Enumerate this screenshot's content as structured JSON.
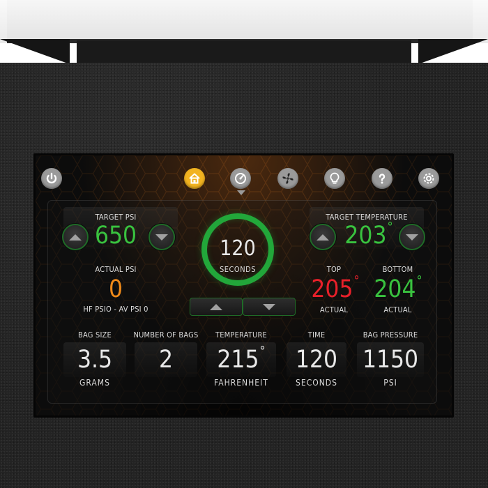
{
  "nav": {
    "icons": [
      {
        "name": "power-icon",
        "active": false
      },
      {
        "name": "home-icon",
        "active": true
      },
      {
        "name": "gauge-icon",
        "active": false
      },
      {
        "name": "fan-icon",
        "active": false
      },
      {
        "name": "lightbulb-icon",
        "active": false
      },
      {
        "name": "help-icon",
        "active": false
      },
      {
        "name": "settings-icon",
        "active": false
      }
    ]
  },
  "target_psi": {
    "label": "TARGET PSI",
    "value": "650"
  },
  "actual_psi": {
    "label": "ACTUAL  PSI",
    "value": "0",
    "sub": "HF PSIO - AV PSI 0"
  },
  "timer": {
    "value": "120",
    "unit": "SECONDS"
  },
  "target_temperature": {
    "label": "TARGET TEMPERATURE",
    "value": "203",
    "deg": "°"
  },
  "top_temp": {
    "label": "TOP",
    "value": "205",
    "deg": "°",
    "sub": "ACTUAL"
  },
  "bottom_temp": {
    "label": "BOTTOM",
    "value": "204",
    "deg": "°",
    "sub": "ACTUAL"
  },
  "stats": [
    {
      "label": "BAG SIZE",
      "value": "3.5",
      "unit": "GRAMS"
    },
    {
      "label": "NUMBER OF BAGS",
      "value": "2",
      "unit": ""
    },
    {
      "label": "TEMPERATURE",
      "value": "215",
      "deg": "°",
      "unit": "FAHRENHEIT"
    },
    {
      "label": "TIME",
      "value": "120",
      "unit": "SECONDS"
    },
    {
      "label": "BAG PRESSURE",
      "value": "1150",
      "unit": "PSI"
    }
  ],
  "colors": {
    "accent_green": "#39c23f",
    "ring_green": "#22a73a",
    "orange": "#f08a19",
    "red": "#e8202a",
    "nav_active": "#f2b320",
    "nav_inactive": "#9a9a9a"
  }
}
